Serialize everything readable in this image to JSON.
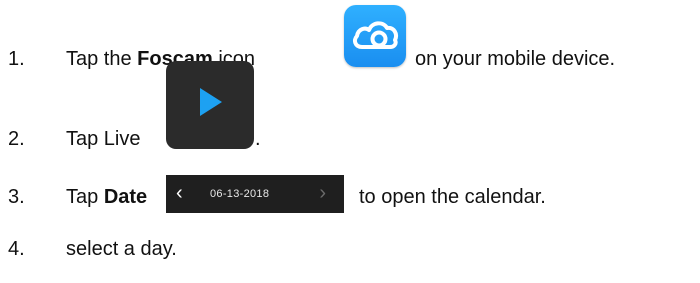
{
  "steps": [
    {
      "number": "1.",
      "prefix": "Tap the ",
      "bold": "Foscam",
      "after_bold": " icon",
      "suffix": " on your mobile device.",
      "icon": "foscam-cloud-icon"
    },
    {
      "number": "2.",
      "prefix": "Tap Live",
      "suffix": ".",
      "icon": "play-icon"
    },
    {
      "number": "3.",
      "prefix": "Tap ",
      "bold": "Date",
      "suffix": " to open the calendar.",
      "icon": "date-selector"
    },
    {
      "number": "4.",
      "text": "select a day."
    }
  ],
  "date_bar": {
    "left_chevron": "‹",
    "date": "06-13-2018",
    "right_chevron": "›"
  },
  "colors": {
    "foscam_blue": "#1f9cf5",
    "dark_bg": "#2b2b2b"
  }
}
